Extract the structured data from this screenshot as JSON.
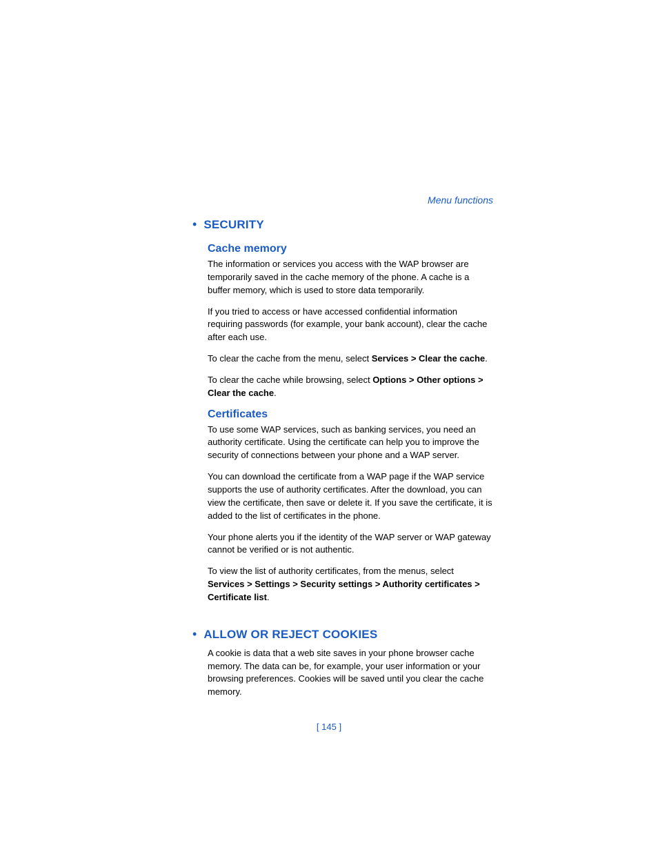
{
  "breadcrumb": "Menu functions",
  "sections": [
    {
      "heading": "SECURITY",
      "subs": [
        {
          "title": "Cache memory",
          "paras": [
            {
              "runs": [
                {
                  "t": "The information or services you access with the WAP browser are temporarily saved in the cache memory of the phone. A cache is a buffer memory, which is used to store data temporarily."
                }
              ]
            },
            {
              "runs": [
                {
                  "t": "If you tried to access or have accessed confidential information requiring passwords (for example, your bank account), clear the cache after each use."
                }
              ]
            },
            {
              "runs": [
                {
                  "t": "To clear the cache from the menu, select "
                },
                {
                  "t": "Services > Clear the cache",
                  "b": true
                },
                {
                  "t": "."
                }
              ]
            },
            {
              "runs": [
                {
                  "t": "To clear the cache while browsing, select "
                },
                {
                  "t": "Options > Other options > Clear the cache",
                  "b": true
                },
                {
                  "t": "."
                }
              ]
            }
          ]
        },
        {
          "title": "Certificates",
          "paras": [
            {
              "runs": [
                {
                  "t": "To use some WAP services, such as banking services, you need an authority certificate. Using the certificate can help you to improve the security of connections between your phone and a WAP server."
                }
              ]
            },
            {
              "runs": [
                {
                  "t": "You can download the certificate from a WAP page if the WAP service supports the use of authority certificates. After the download, you can view the certificate, then save or delete it. If you save the certificate, it is added to the list of certificates in the phone."
                }
              ]
            },
            {
              "runs": [
                {
                  "t": "Your phone alerts you if the identity of the WAP server or WAP gateway cannot be verified or is not authentic."
                }
              ]
            },
            {
              "runs": [
                {
                  "t": "To view the list of authority certificates, from the menus, select "
                },
                {
                  "t": "Services > Settings > Security settings > Authority certificates > Certificate list",
                  "b": true
                },
                {
                  "t": "."
                }
              ]
            }
          ]
        }
      ]
    },
    {
      "heading": "ALLOW OR REJECT COOKIES",
      "subs": [
        {
          "title": "",
          "paras": [
            {
              "runs": [
                {
                  "t": "A cookie is data that a web site saves in your phone browser cache memory. The data can be, for example, your user information or your browsing preferences. Cookies will be saved until you clear the cache memory."
                }
              ]
            }
          ]
        }
      ]
    }
  ],
  "page_number": "[ 145 ]"
}
